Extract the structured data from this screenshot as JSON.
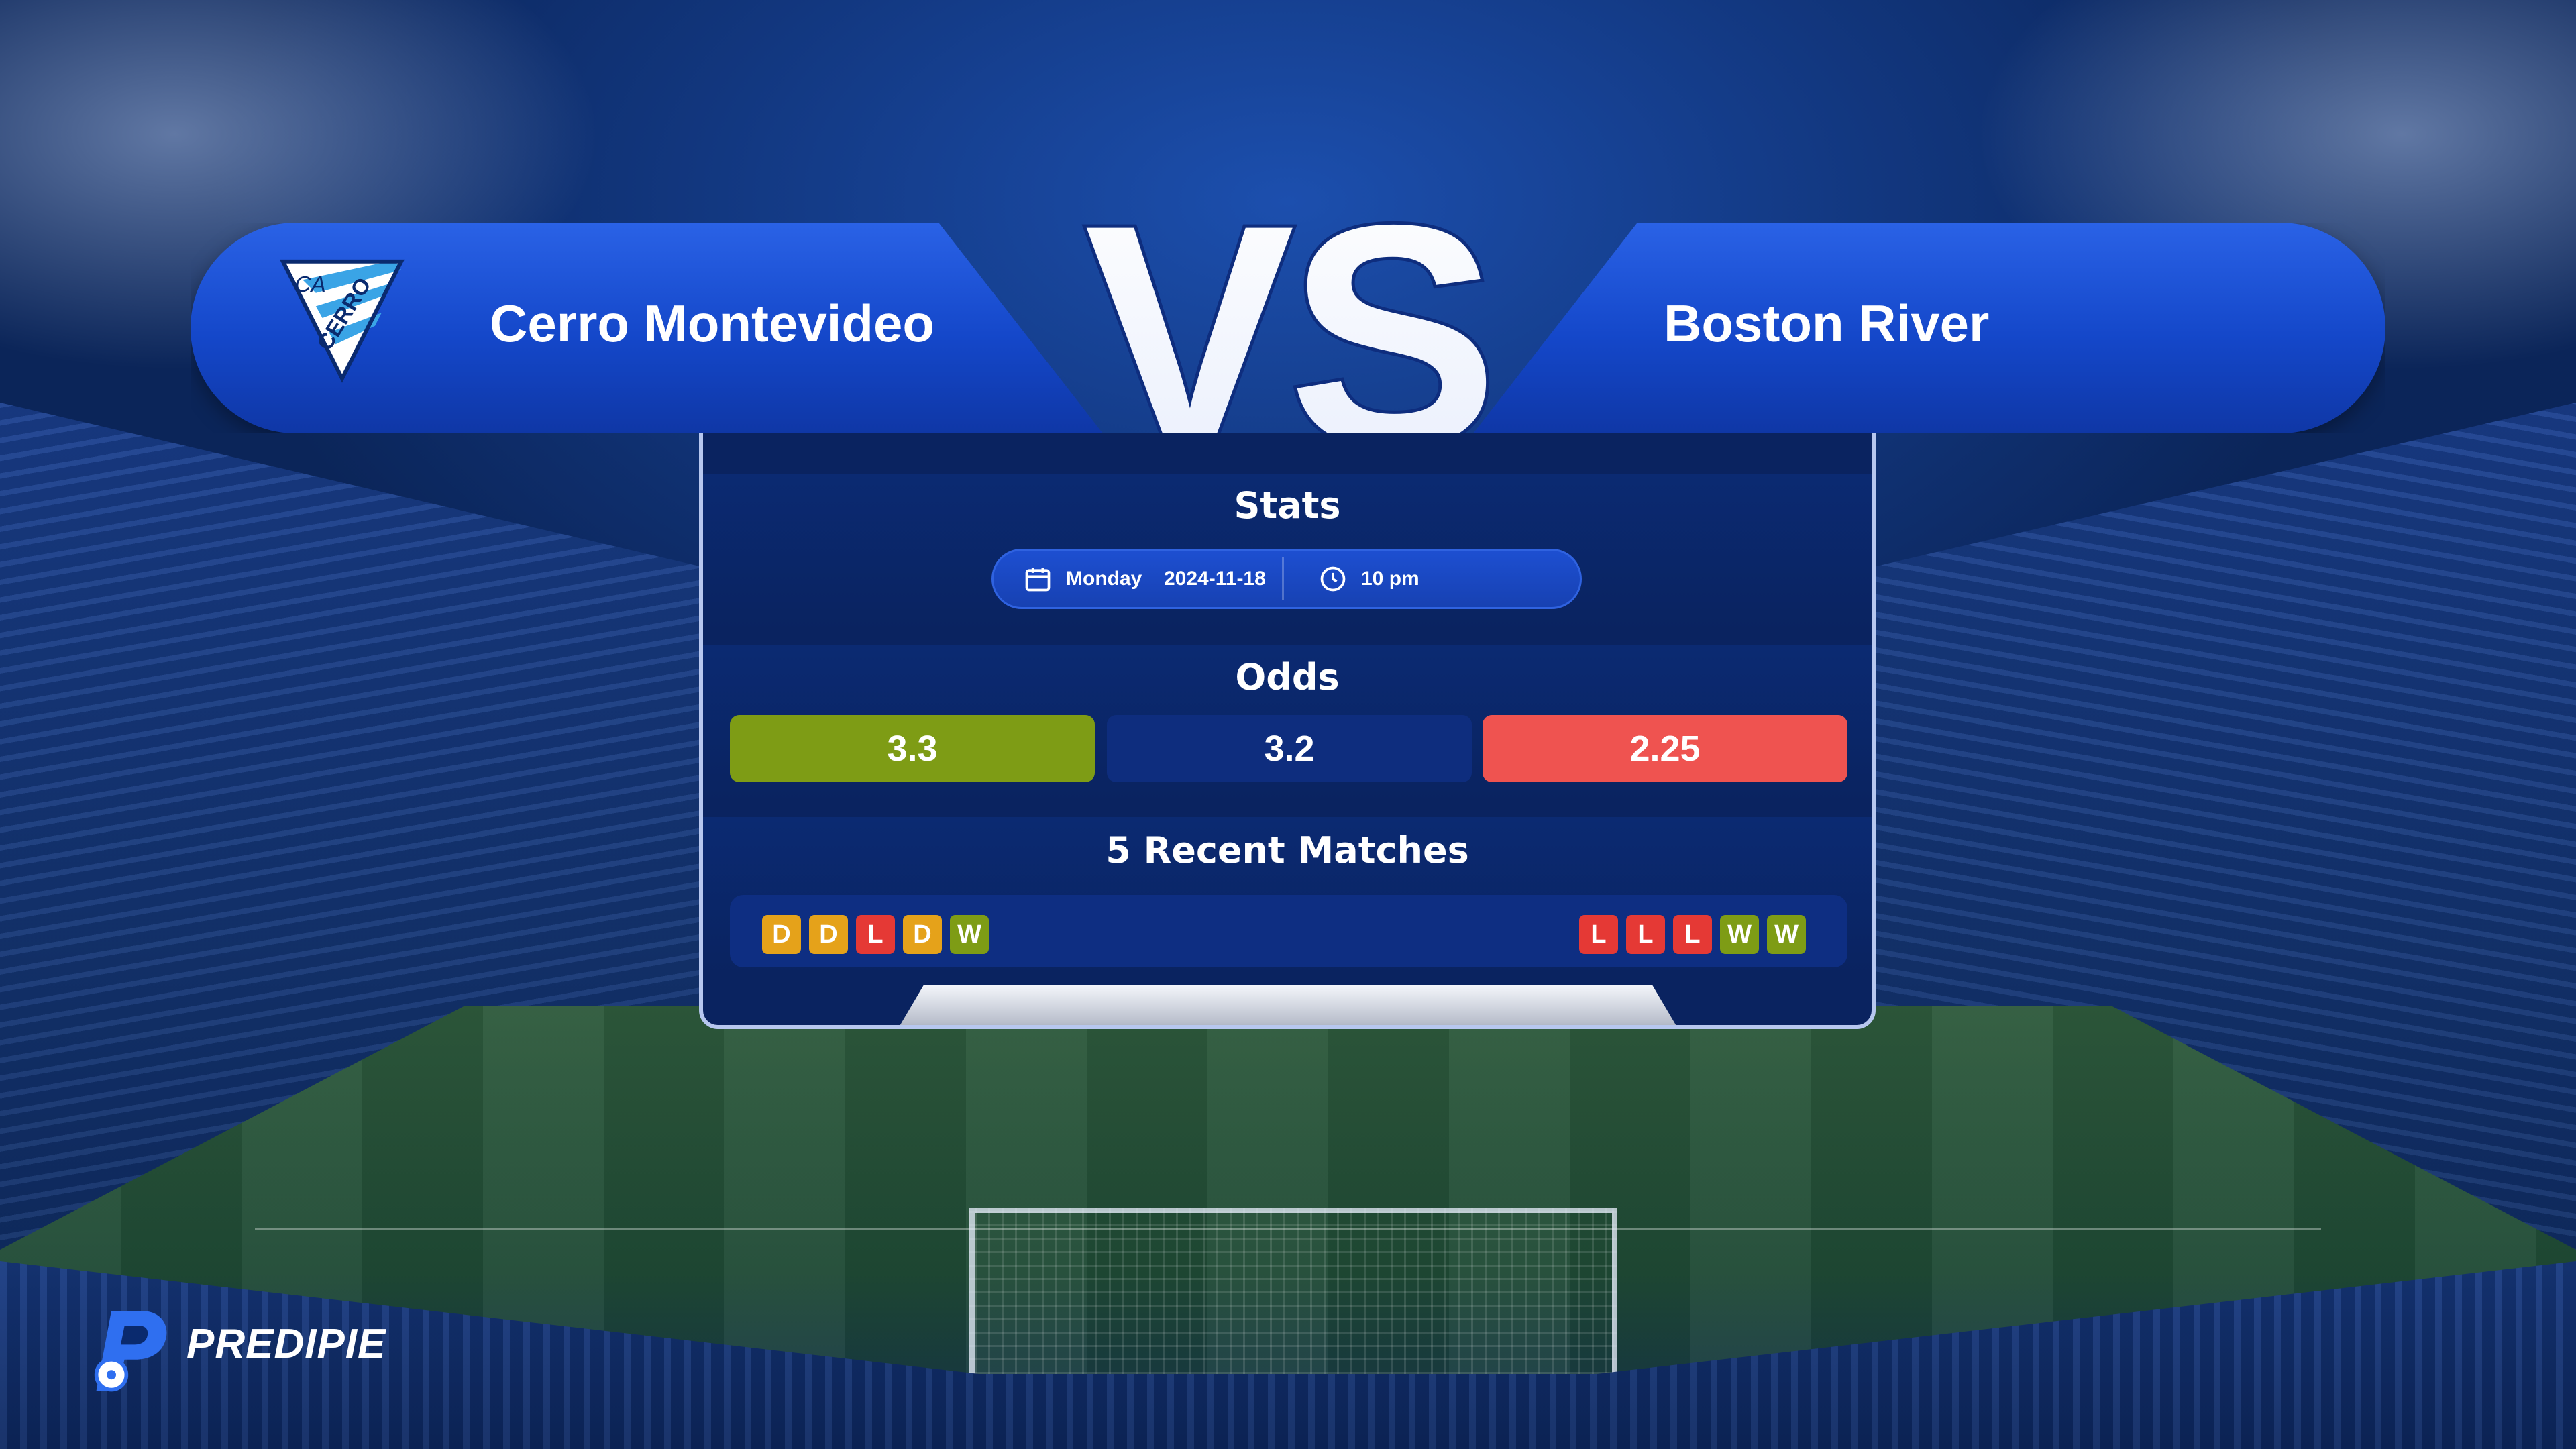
{
  "match": {
    "home_team": "Cerro Montevideo",
    "away_team": "Boston River",
    "vs_label": "VS",
    "home_crest_text": "CERRO",
    "home_crest_initials": "CA"
  },
  "stats": {
    "title": "Stats",
    "day": "Monday",
    "date": "2024-11-18",
    "time": "10 pm"
  },
  "odds": {
    "title": "Odds",
    "home": "3.3",
    "draw": "3.2",
    "away": "2.25"
  },
  "recent": {
    "title": "5 Recent Matches",
    "home_form": [
      "D",
      "D",
      "L",
      "D",
      "W"
    ],
    "away_form": [
      "L",
      "L",
      "L",
      "W",
      "W"
    ]
  },
  "colors": {
    "win": "#7e9c15",
    "draw": "#e5a21a",
    "loss": "#e53935",
    "odds_home": "#7e9c15",
    "odds_draw": "#0e2d7e",
    "odds_away": "#ef5350"
  },
  "brand": {
    "name": "PREDIPIE"
  }
}
